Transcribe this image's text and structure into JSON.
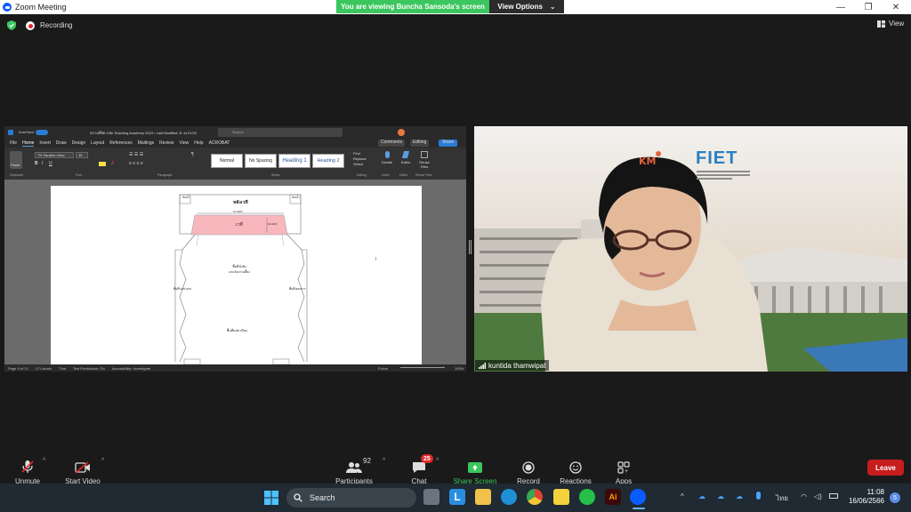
{
  "window": {
    "title": "Zoom Meeting"
  },
  "banner": {
    "message": "You are viewing Buncha Sansoda's screen",
    "options_label": "View Options"
  },
  "recording": {
    "label": "Recording"
  },
  "view": {
    "label": "View"
  },
  "word": {
    "doc_title": "สถานที่จัด 10th Teaching Academy 2023 • Last Modified: ต. at 21:53",
    "search_placeholder": "Search",
    "menu": [
      "File",
      "Home",
      "Insert",
      "Draw",
      "Design",
      "Layout",
      "References",
      "Mailings",
      "Review",
      "View",
      "Help",
      "ACROBAT"
    ],
    "styles": [
      "Normal",
      "No Spacing",
      "Heading 1",
      "Heading 2"
    ],
    "comments_label": "Comments",
    "editing_label": "Editing",
    "share_label": "Share",
    "font": "TH Sarabun New",
    "font_size": "16",
    "ribbon_groups": [
      "Clipboard",
      "Font",
      "Paragraph",
      "Styles",
      "Editing",
      "Voice",
      "Editor",
      "Reuse Files"
    ],
    "ribbon_buttons": [
      "Paste",
      "Find",
      "Replace",
      "Select",
      "Dictate",
      "Editor",
      "Reuse Files"
    ],
    "status": [
      "Page 9 of 13",
      "171 words",
      "Thai",
      "Text Predictions: On",
      "Accessibility: Investigate"
    ],
    "status_right": [
      "Focus",
      "100%"
    ],
    "diagram": {
      "top_label": "หลังเวที",
      "stage_label": "เวที",
      "stage_width": "10 เมตร",
      "stage_depth": "10 เมตร",
      "left_box": "ห้องน้ำ",
      "right_box": "ห้องน้ำ",
      "center_text": "พื้นที่นั่งฟัง\nและจัดงานเลี้ยง",
      "left_side": "พื้นที่รับประทาน",
      "right_side": "พื้นที่จัดอาหาร",
      "bottom_text": "พื้นที่ลงทะเบียน"
    }
  },
  "video": {
    "participant_name": "kuntida thamwipat",
    "logo_text": "FIET"
  },
  "toolbar": {
    "unmute": "Unmute",
    "start_video": "Start Video",
    "participants": "Participants",
    "participant_count": "92",
    "chat": "Chat",
    "chat_badge": "25",
    "share": "Share Screen",
    "record": "Record",
    "reactions": "Reactions",
    "apps": "Apps",
    "leave": "Leave"
  },
  "taskbar": {
    "search_label": "Search",
    "time": "11:08",
    "date": "16/06/2566",
    "lang": "ไทย",
    "notification_count": "5"
  },
  "colors": {
    "share_green": "#3cc65f",
    "leave_red": "#c71d1d",
    "zoom_blue": "#0b5cff"
  }
}
